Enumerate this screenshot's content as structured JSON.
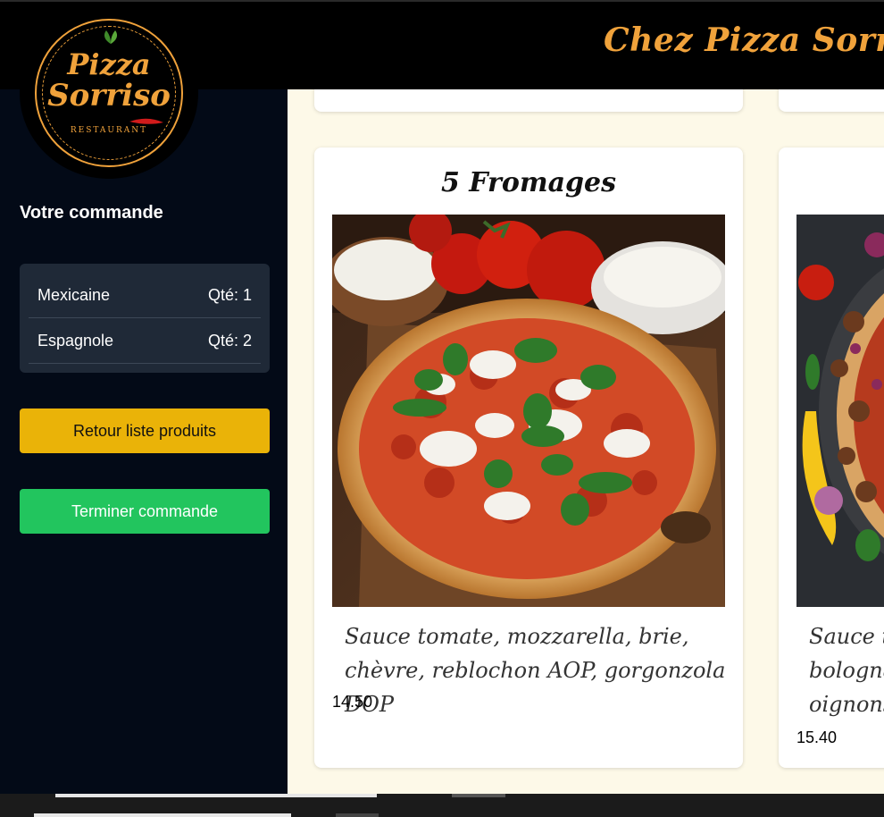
{
  "header": {
    "title": "Chez Pizza Sorrizo, l"
  },
  "logo": {
    "line1": "Pizza",
    "line2": "Sorriso",
    "line3": "RESTAURANT"
  },
  "order": {
    "title": "Votre commande",
    "items": [
      {
        "name": "Mexicaine",
        "qty": "Qté: 1"
      },
      {
        "name": "Espagnole",
        "qty": "Qté: 2"
      }
    ]
  },
  "buttons": {
    "back": "Retour liste produits",
    "finish": "Terminer commande"
  },
  "products": [
    {
      "name": "5 Fromages",
      "description": "Sauce tomate, mozzarella, brie, chèvre, reblochon AOP, gorgonzola DOP",
      "price": "14.50"
    },
    {
      "name": "",
      "description_lines": [
        "Sauce to",
        "bolognai",
        "oignons"
      ],
      "price": "15.40"
    }
  ],
  "colors": {
    "accent": "#f0a23b",
    "sidebar": "#030a17",
    "back_button": "#eab308",
    "finish_button": "#22c55e",
    "page_bg": "#fdf9e8"
  }
}
